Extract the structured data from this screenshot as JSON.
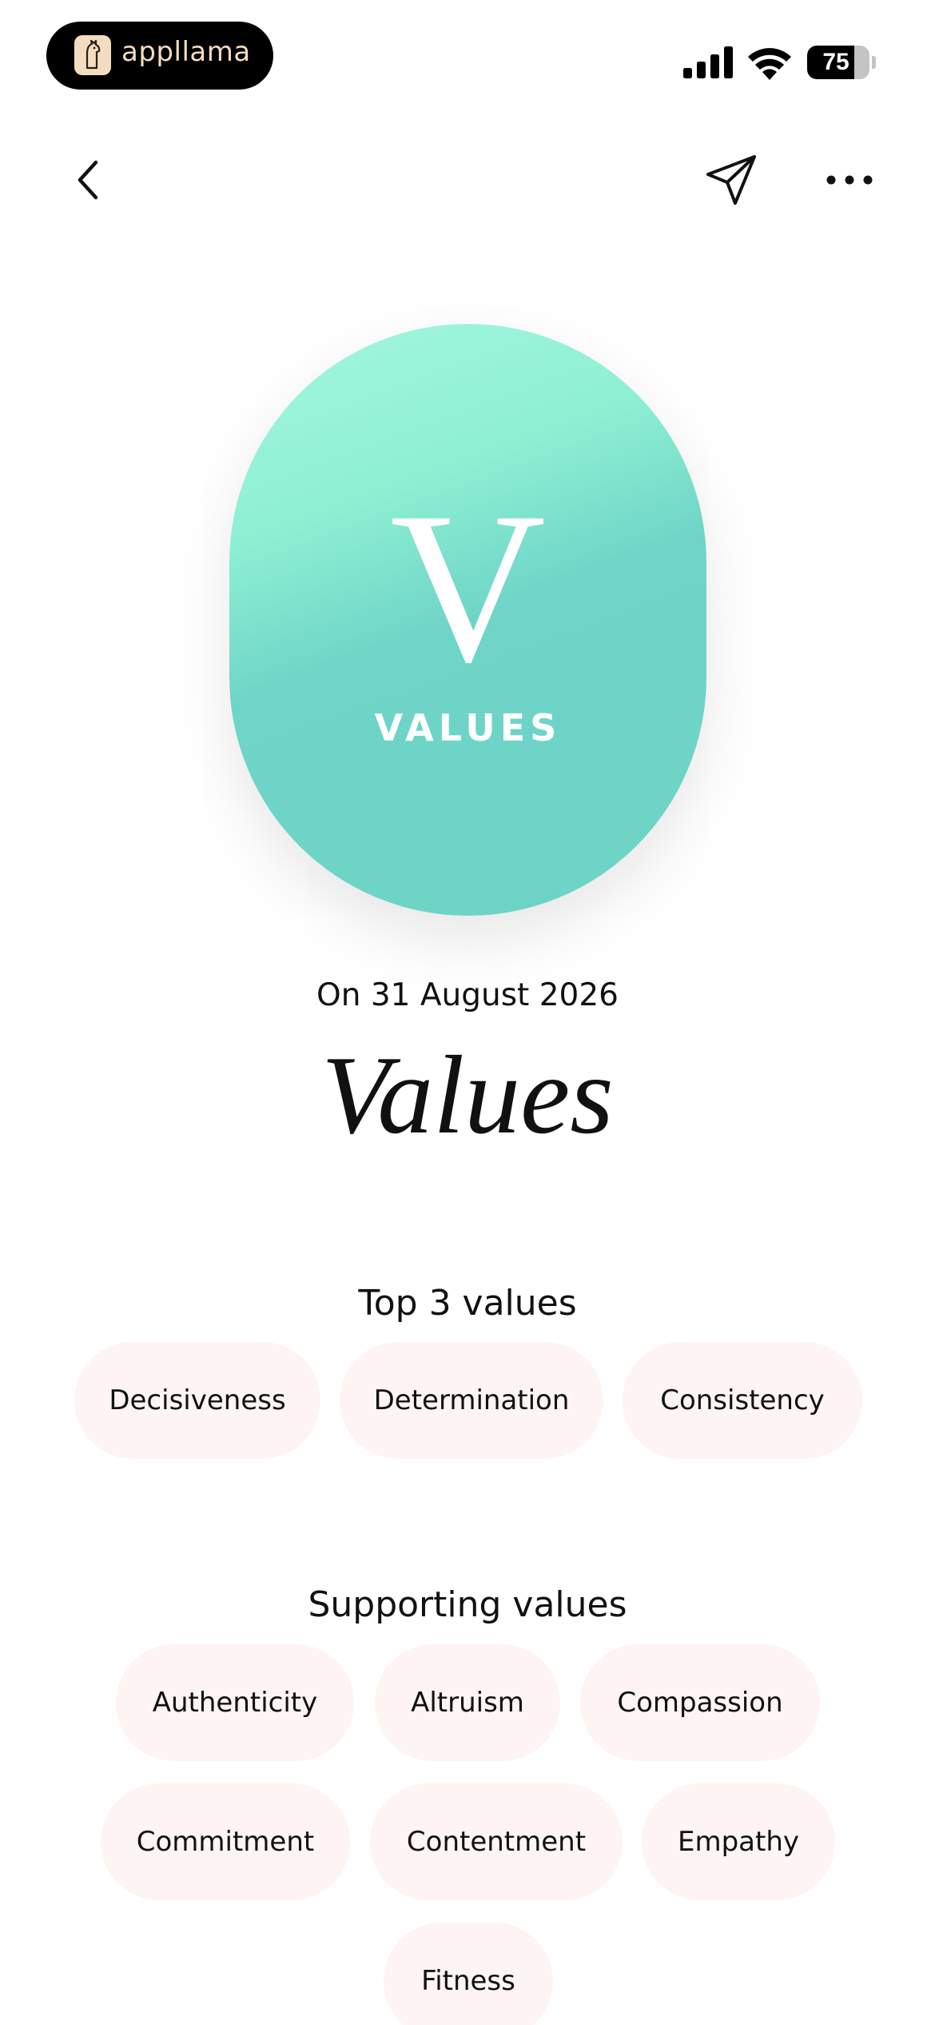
{
  "status_bar": {
    "app_name": "appllama",
    "battery_level": 75,
    "battery_text": "75",
    "signal_icon": "cellular-signal-icon",
    "wifi_icon": "wifi-icon"
  },
  "nav": {
    "back_icon": "chevron-left-icon",
    "share_icon": "paper-plane-icon",
    "more_icon": "ellipsis-icon"
  },
  "hero": {
    "letter": "V",
    "label": "VALUES",
    "colors": {
      "top": "#a3f7df",
      "bottom": "#6dd3c6"
    }
  },
  "date_line": "On 31 August 2026",
  "title": "Values",
  "top_values": {
    "heading": "Top 3 values",
    "items": [
      "Decisiveness",
      "Determination",
      "Consistency"
    ]
  },
  "supporting_values": {
    "heading": "Supporting values",
    "items": [
      "Authenticity",
      "Altruism",
      "Compassion",
      "Commitment",
      "Contentment",
      "Empathy",
      "Fitness"
    ]
  },
  "colors": {
    "chip_bg": "#fdf4f3",
    "text": "#111111"
  }
}
